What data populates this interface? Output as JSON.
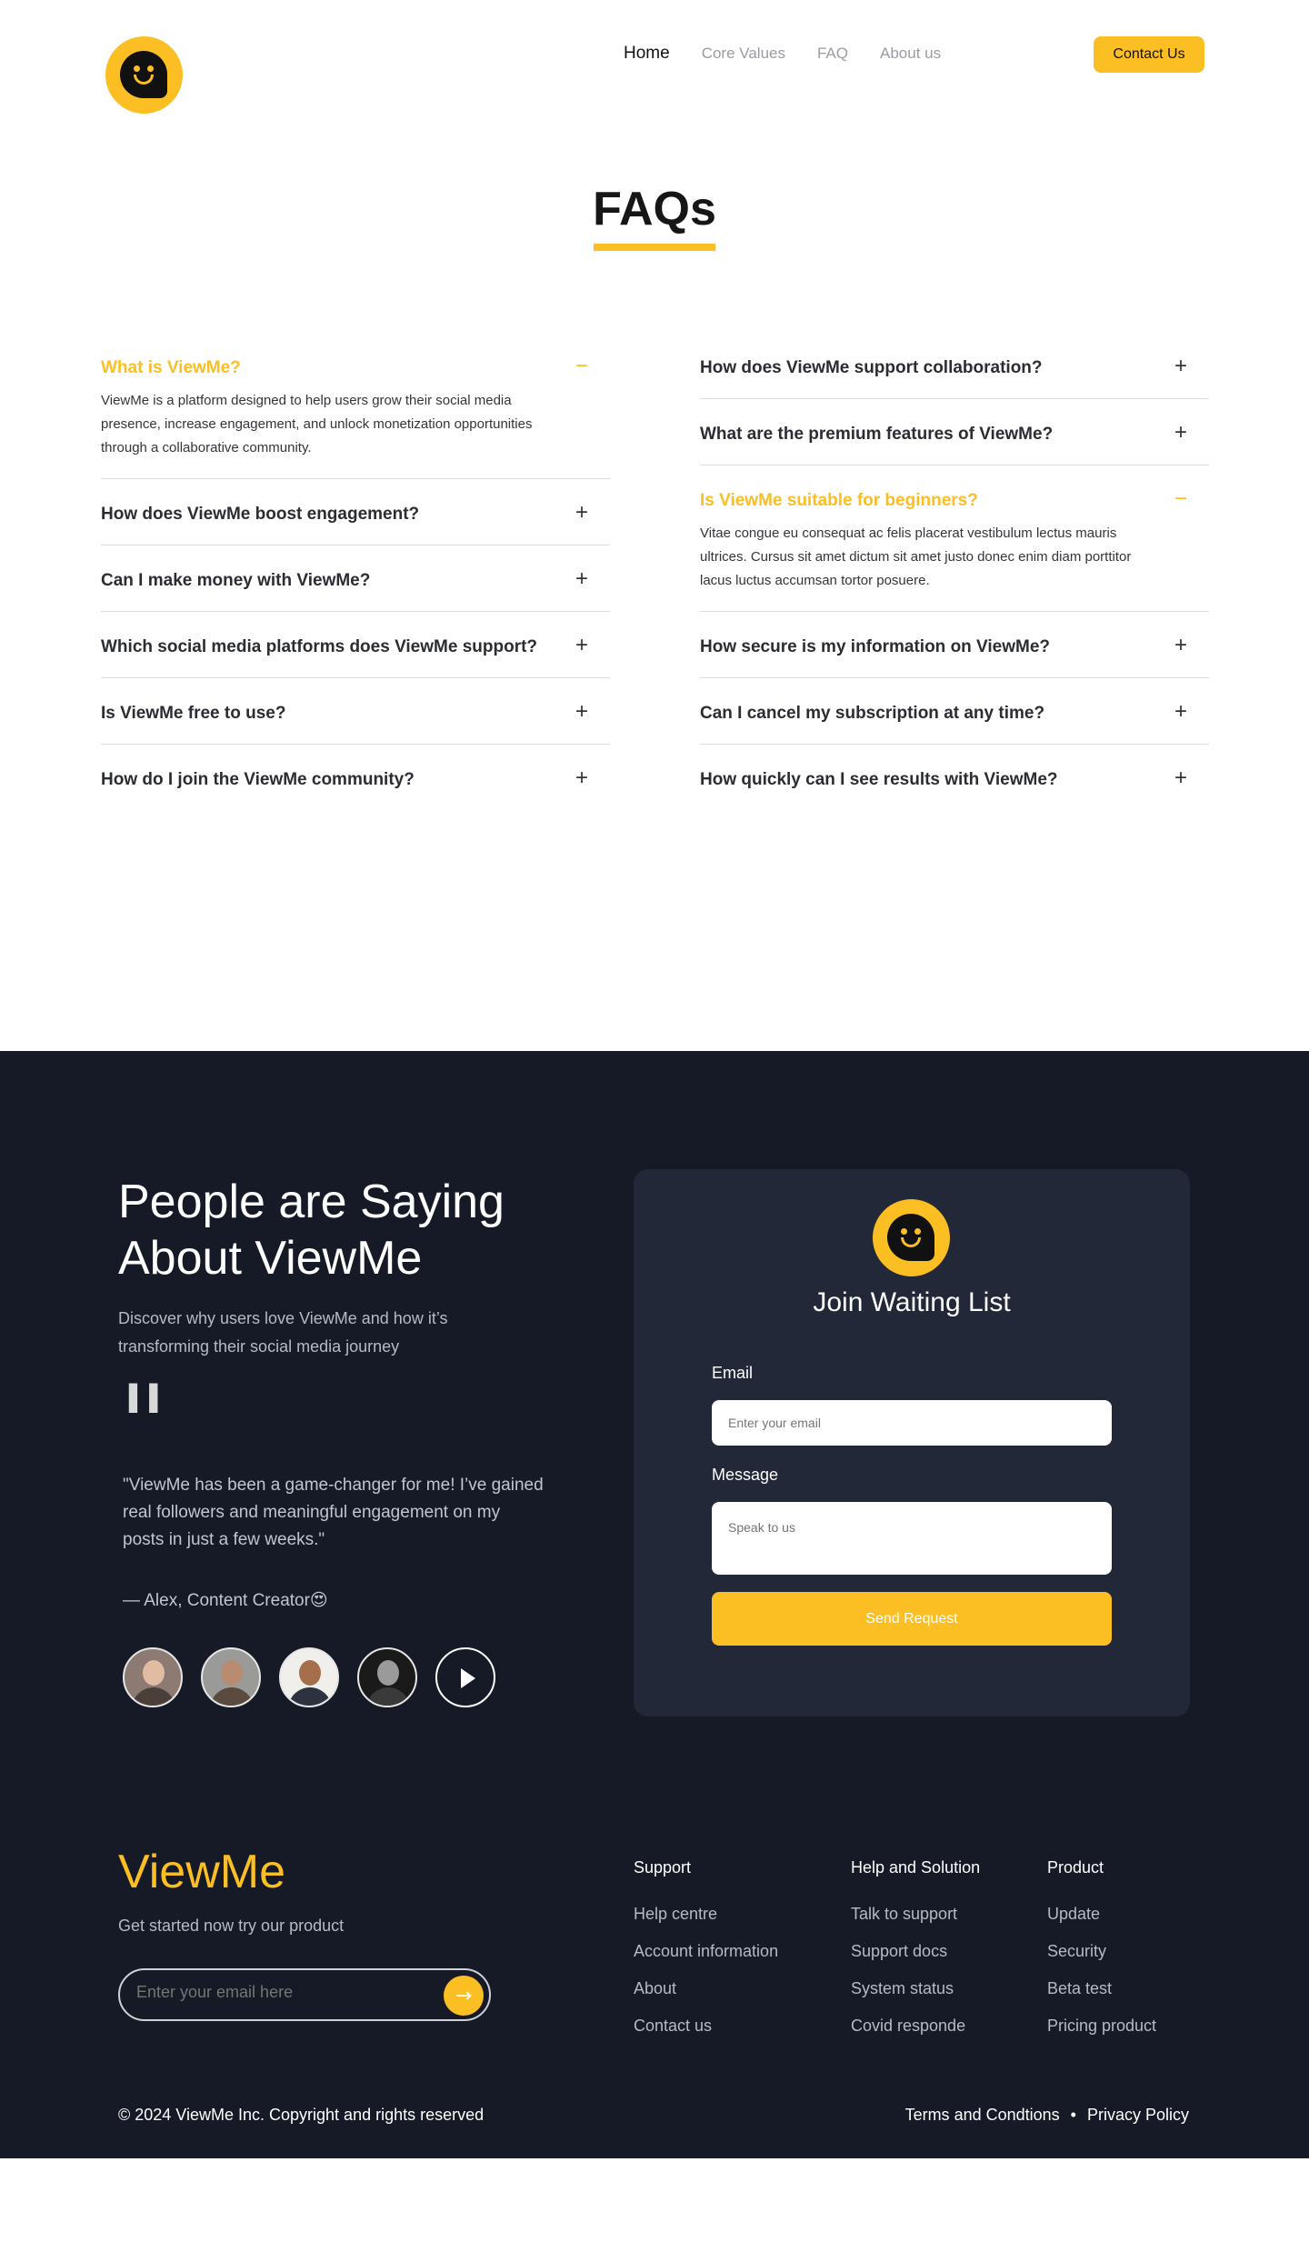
{
  "header": {
    "nav": [
      "Home",
      "Core Values",
      "FAQ",
      "About us"
    ],
    "contact_label": "Contact Us"
  },
  "faq": {
    "title": "FAQs",
    "left": [
      {
        "q": "What is ViewMe?",
        "a": "ViewMe is a platform designed to help users grow their social media presence, increase engagement, and unlock monetization opportunities through a collaborative community.",
        "open": true
      },
      {
        "q": "How does ViewMe boost engagement?",
        "open": false
      },
      {
        "q": "Can I make money with ViewMe?",
        "open": false
      },
      {
        "q": "Which social media platforms does ViewMe support?",
        "open": false
      },
      {
        "q": "Is ViewMe free to use?",
        "open": false
      },
      {
        "q": "How do I join the ViewMe community?",
        "open": false
      }
    ],
    "right": [
      {
        "q": "How does ViewMe support collaboration?",
        "open": false
      },
      {
        "q": "What are the premium features of ViewMe?",
        "open": false
      },
      {
        "q": "Is ViewMe suitable for beginners?",
        "a": "Vitae congue eu consequat ac felis placerat vestibulum lectus mauris ultrices. Cursus sit amet dictum sit amet justo donec enim diam porttitor lacus luctus accumsan tortor posuere.",
        "open": true
      },
      {
        "q": "How secure is my information on ViewMe?",
        "open": false
      },
      {
        "q": "Can I cancel my subscription at any time?",
        "open": false
      },
      {
        "q": "How quickly can I see results with ViewMe?",
        "open": false
      }
    ],
    "plus_icon": "+",
    "minus_icon": "−"
  },
  "testimonials": {
    "title": "People are Saying About ViewMe",
    "subtitle": "Discover why users love ViewMe and how it’s transforming their social media journey",
    "quote": "\"ViewMe has been a game-changer for me! I’ve gained real followers and meaningful engagement on my posts in just a few weeks.\"",
    "author": "— Alex, Content Creator😍"
  },
  "waitlist": {
    "title": "Join Waiting List",
    "email_label": "Email",
    "email_placeholder": "Enter your email",
    "message_label": "Message",
    "message_placeholder": "Speak to us",
    "send_label": "Send Request"
  },
  "footer": {
    "brand": "ViewMe",
    "tagline": "Get started now try our product",
    "newsletter_placeholder": "Enter your email here",
    "columns": [
      {
        "title": "Support",
        "links": [
          "Help centre",
          "Account information",
          "About",
          "Contact us"
        ]
      },
      {
        "title": "Help and Solution",
        "links": [
          "Talk to support",
          "Support docs",
          "System status",
          "Covid responde"
        ]
      },
      {
        "title": "Product",
        "links": [
          "Update",
          "Security",
          "Beta test",
          "Pricing product"
        ]
      }
    ],
    "copyright": "© 2024 ViewMe Inc. Copyright and rights reserved",
    "terms": "Terms and Condtions",
    "privacy": "Privacy Policy"
  },
  "colors": {
    "accent": "#fbbf24",
    "dark_bg": "#161a26",
    "card_bg": "#232838"
  }
}
